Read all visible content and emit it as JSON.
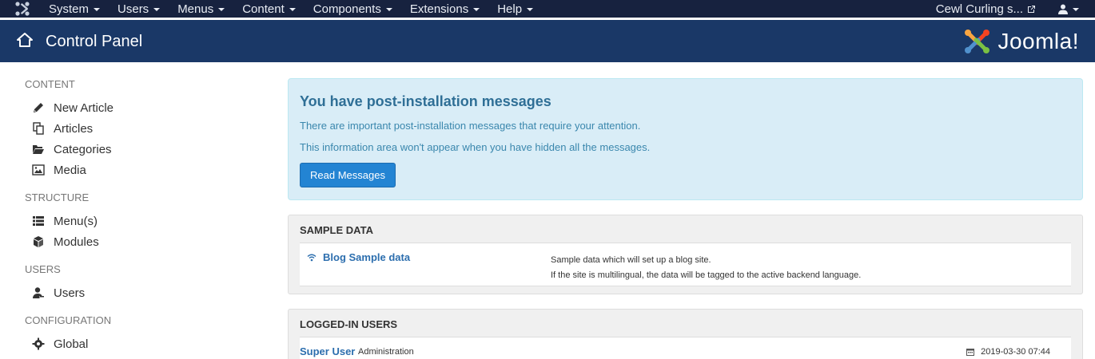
{
  "navbar": {
    "menu": [
      "System",
      "Users",
      "Menus",
      "Content",
      "Components",
      "Extensions",
      "Help"
    ],
    "site_name": "Cewl Curling s..."
  },
  "header": {
    "title": "Control Panel",
    "brand": "Joomla!"
  },
  "sidebar": {
    "groups": [
      {
        "heading": "CONTENT",
        "items": [
          "New Article",
          "Articles",
          "Categories",
          "Media"
        ]
      },
      {
        "heading": "STRUCTURE",
        "items": [
          "Menu(s)",
          "Modules"
        ]
      },
      {
        "heading": "USERS",
        "items": [
          "Users"
        ]
      },
      {
        "heading": "CONFIGURATION",
        "items": [
          "Global"
        ]
      }
    ]
  },
  "alert": {
    "title": "You have post-installation messages",
    "line1": "There are important post-installation messages that require your attention.",
    "line2": "This information area won't appear when you have hidden all the messages.",
    "button": "Read Messages"
  },
  "sample_data": {
    "title": "SAMPLE DATA",
    "item_name": "Blog Sample data",
    "desc1": "Sample data which will set up a blog site.",
    "desc2": "If the site is multilingual, the data will be tagged to the active backend language."
  },
  "logged_in": {
    "title": "LOGGED-IN USERS",
    "user": "Super User",
    "role": "Administration",
    "time": "2019-03-30 07:44"
  },
  "colors": {
    "navbar": "#17223f",
    "header": "#1a3867",
    "alert_bg": "#d9edf7",
    "primary": "#2384d3",
    "link": "#2c6eae"
  }
}
